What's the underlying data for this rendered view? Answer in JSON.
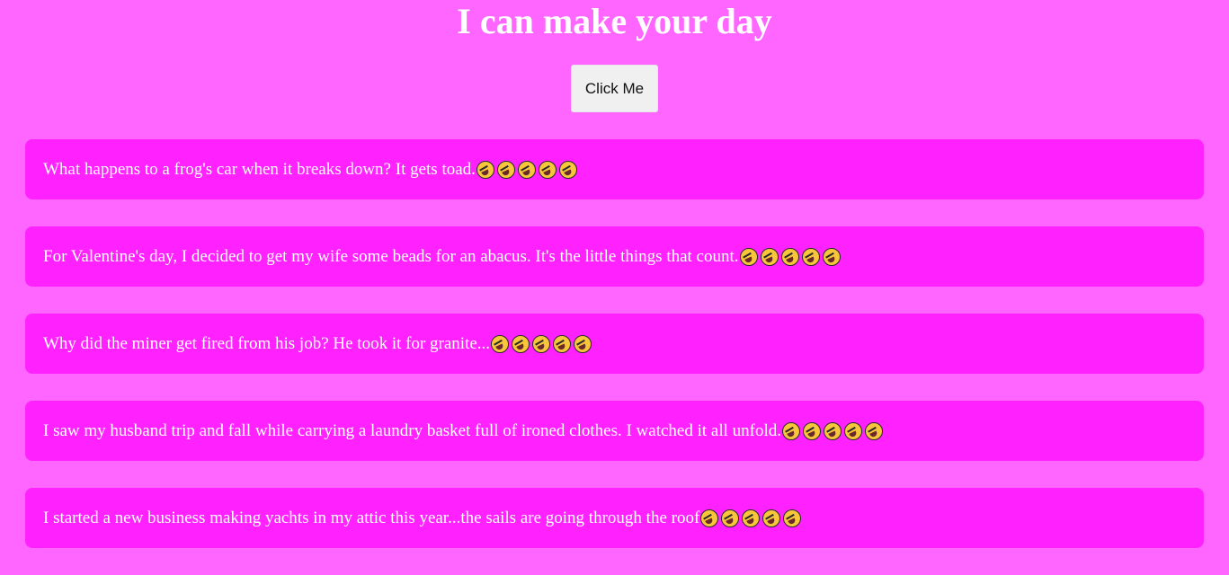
{
  "page": {
    "title": "I can make your day",
    "button_label": "Click Me"
  },
  "jokes": [
    {
      "text": "What happens to a frog's car when it breaks down? It gets toad.",
      "emoji_icon": "rofl-icon",
      "emoji_count": 5
    },
    {
      "text": "For Valentine's day, I decided to get my wife some beads for an abacus. It's the little things that count.",
      "emoji_icon": "rofl-icon",
      "emoji_count": 5
    },
    {
      "text": "Why did the miner get fired from his job? He took it for granite...",
      "emoji_icon": "rofl-icon",
      "emoji_count": 5
    },
    {
      "text": "I saw my husband trip and fall while carrying a laundry basket full of ironed clothes. I watched it all unfold.",
      "emoji_icon": "rofl-icon",
      "emoji_count": 5
    },
    {
      "text": "I started a new business making yachts in my attic this year...the sails are going through the roof",
      "emoji_icon": "rofl-icon",
      "emoji_count": 5
    }
  ],
  "colors": {
    "background": "#ff66ff",
    "card": "#ff22ff",
    "text": "#ffffff",
    "button": "#f0f0f0"
  }
}
